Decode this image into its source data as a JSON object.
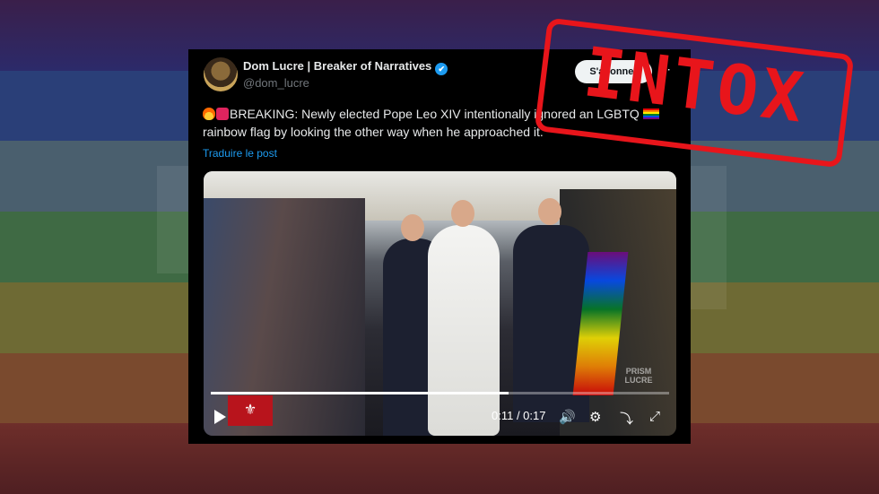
{
  "background": {
    "colors": [
      "#3a1f4a",
      "#2a3f78",
      "#4a5f6e",
      "#3f6a44",
      "#6e6a34",
      "#7a4a2e",
      "#6e2e2a"
    ]
  },
  "post": {
    "author_name": "Dom Lucre | Breaker of Narratives",
    "handle": "@dom_lucre",
    "verified_icon": "verified-badge-icon",
    "follow_label": "S'abonner",
    "tweet_before_flag": "BREAKING: Newly elected Pope Leo XIV intentionally ignored an LGBTQ",
    "tweet_after_flag": "rainbow flag by looking the other way when he approached it.",
    "translate_label": "Traduire le post"
  },
  "video": {
    "progress": 0.65,
    "time_label": "0:11 / 0:17",
    "watermark": "PRISM LUCRE"
  },
  "stamp": {
    "text": "INTOX",
    "color": "#e8151b"
  }
}
